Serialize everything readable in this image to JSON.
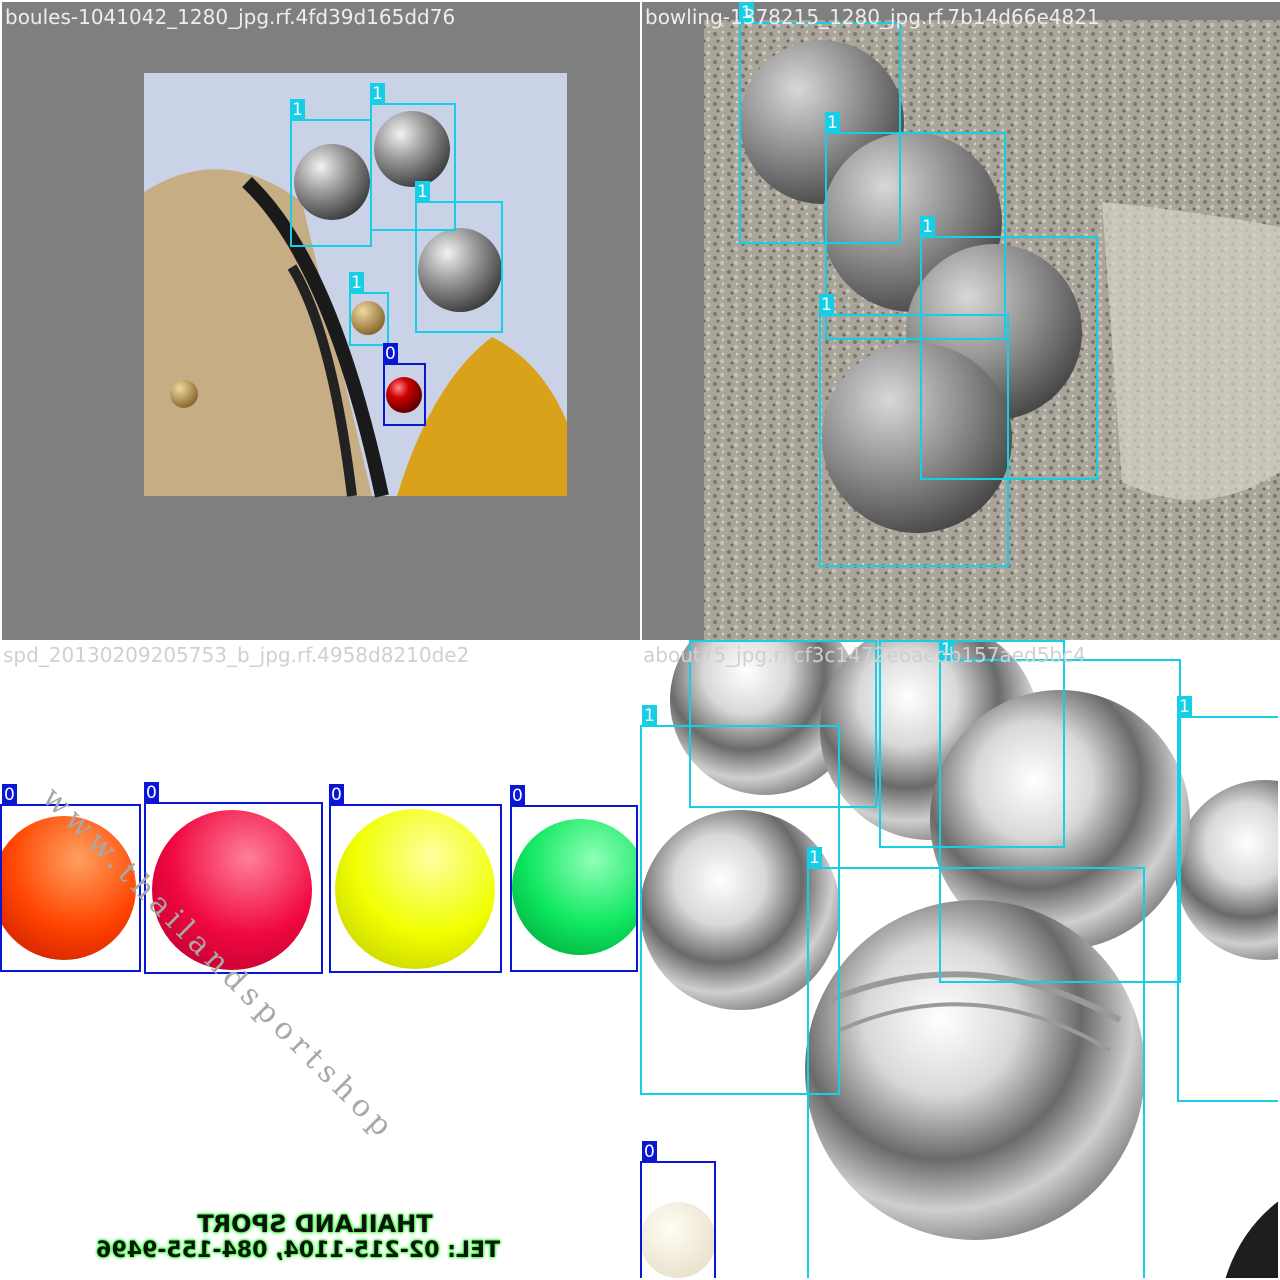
{
  "colors": {
    "class_0": "#0a16d6",
    "class_1": "#14cfe6"
  },
  "tiles": [
    {
      "filename": "boules-1041042_1280_jpg.rf.4fd39d165dd76",
      "boxes": [
        {
          "label": "1"
        },
        {
          "label": "1"
        },
        {
          "label": "1"
        },
        {
          "label": "1"
        },
        {
          "label": "0"
        }
      ]
    },
    {
      "filename": "bowling-1378215_1280_jpg.rf.7b14d66e4821",
      "boxes": [
        {
          "label": "1"
        },
        {
          "label": "1"
        },
        {
          "label": "1"
        },
        {
          "label": "1"
        }
      ]
    },
    {
      "filename": "spd_20130209205753_b_jpg.rf.4958d8210de2",
      "watermark": "www.thailandsportshop",
      "sign": {
        "line1": "THAILAND SPORT",
        "line2": "TEL: 02-215-1104, 084-155-9496"
      },
      "boxes": [
        {
          "label": "0"
        },
        {
          "label": "0"
        },
        {
          "label": "0"
        },
        {
          "label": "0"
        }
      ]
    },
    {
      "filename": "about75_jpg.rf.cf3c1472e6aedb157aed5bc4",
      "boxes": [
        {
          "label": "1"
        },
        {
          "label": "1"
        },
        {
          "label": "1"
        },
        {
          "label": "1"
        },
        {
          "label": "1"
        },
        {
          "label": "1"
        },
        {
          "label": "0"
        }
      ]
    }
  ]
}
